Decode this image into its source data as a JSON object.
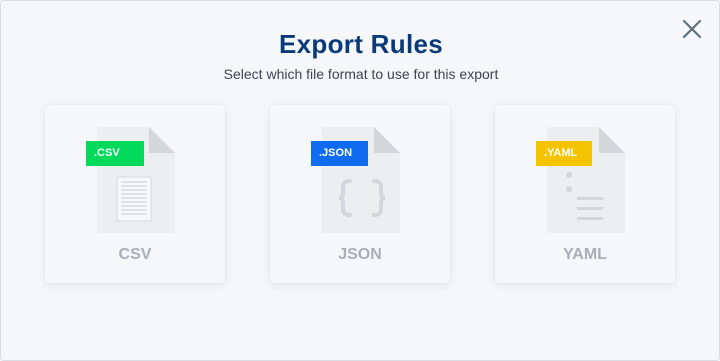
{
  "dialog": {
    "title": "Export Rules",
    "subtitle": "Select which file format to use for this export"
  },
  "formats": [
    {
      "tag": ".CSV",
      "label": "CSV",
      "tag_color": "#00d95a",
      "icon": "spreadsheet-lines-icon"
    },
    {
      "tag": ".JSON",
      "label": "JSON",
      "tag_color": "#0f6bf0",
      "icon": "curly-braces-icon"
    },
    {
      "tag": ".YAML",
      "label": "YAML",
      "tag_color": "#f5c400",
      "icon": "yaml-list-icon"
    }
  ],
  "colors": {
    "title": "#0b3a78",
    "label": "#a9afb9",
    "doc": "#eceeef"
  }
}
